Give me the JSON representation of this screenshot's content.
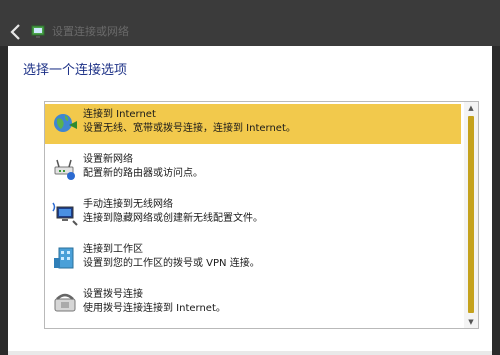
{
  "window": {
    "title": "设置连接或网络",
    "back_icon": "back-arrow-icon",
    "title_icon": "network-setup-icon"
  },
  "heading": "选择一个连接选项",
  "colors": {
    "selected_highlight": "#f2c94c",
    "scroll_thumb": "#c5a21d",
    "heading_text": "#1e3287",
    "frame_dark": "#3b3b3b"
  },
  "options": [
    {
      "title": "连接到 Internet",
      "desc": "设置无线、宽带或拨号连接，连接到 Internet。",
      "icon": "internet-globe-icon",
      "selected": true
    },
    {
      "title": "设置新网络",
      "desc": "配置新的路由器或访问点。",
      "icon": "router-setup-icon",
      "selected": false
    },
    {
      "title": "手动连接到无线网络",
      "desc": "连接到隐藏网络或创建新无线配置文件。",
      "icon": "wireless-network-icon",
      "selected": false
    },
    {
      "title": "连接到工作区",
      "desc": "设置到您的工作区的拨号或 VPN 连接。",
      "icon": "workplace-building-icon",
      "selected": false
    },
    {
      "title": "设置拨号连接",
      "desc": "使用拨号连接连接到 Internet。",
      "icon": "dialup-phone-icon",
      "selected": false
    }
  ],
  "scrollbar": {
    "up_glyph": "▲",
    "down_glyph": "▼"
  }
}
